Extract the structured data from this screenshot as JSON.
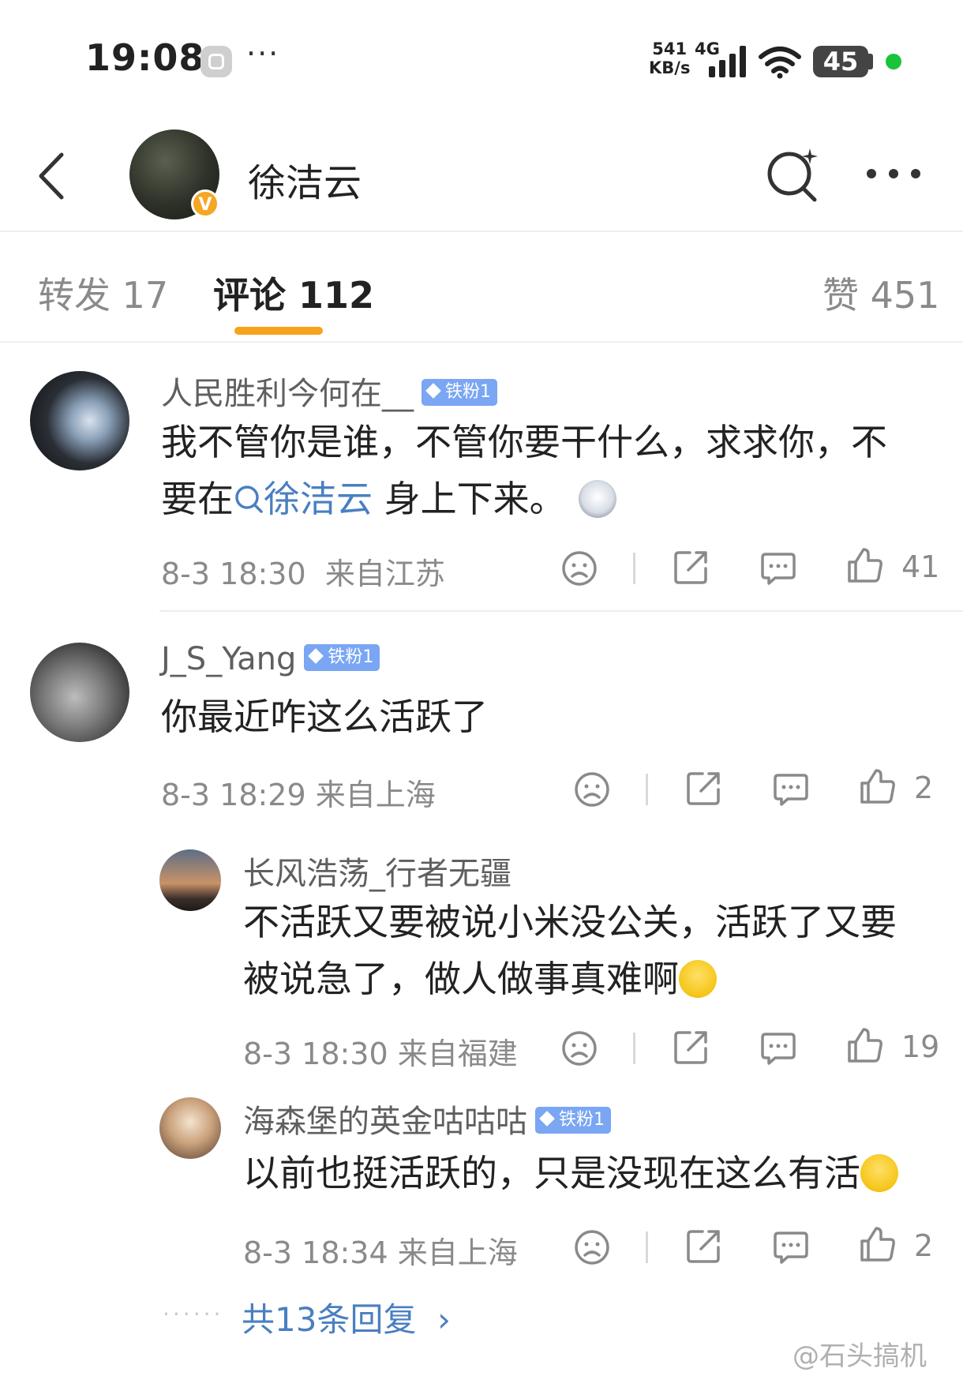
{
  "status_bar": {
    "time": "19:08",
    "more": "···",
    "speed_value": "541",
    "speed_unit": "KB/s",
    "network": "4G",
    "battery": "45"
  },
  "header": {
    "owner_name": "徐洁云",
    "verified_badge": "V"
  },
  "tabs": [
    {
      "label": "转发 17"
    },
    {
      "label": "评论 112"
    },
    {
      "label": "赞 451"
    }
  ],
  "comments": [
    {
      "user": "人民胜利今何在__",
      "badge": "铁粉1",
      "text_a": "我不管你是谁，不管你要干什么，求求你，不",
      "text_b": "要在",
      "mention": "徐洁云",
      "text_c": " 身上下来。",
      "time": "8-3 18:30",
      "location": "来自江苏",
      "likes": "41"
    },
    {
      "user": "J_S_Yang",
      "badge": "铁粉1",
      "text": "你最近咋这么活跃了",
      "time": "8-3 18:29",
      "location": "来自上海",
      "likes": "2"
    }
  ],
  "replies": [
    {
      "user": "长风浩荡_行者无疆",
      "text_a": "不活跃又要被说小米没公关，活跃了又要",
      "text_b": "被说急了，做人做事真难啊",
      "time": "8-3 18:30",
      "location": "来自福建",
      "likes": "19"
    },
    {
      "user": "海森堡的英金咕咕咕",
      "badge": "铁粉1",
      "text": "以前也挺活跃的，只是没现在这么有活",
      "time": "8-3 18:34",
      "location": "来自上海",
      "likes": "2"
    }
  ],
  "more_replies": "共13条回复",
  "more_replies_chevron": "›",
  "dots": "······",
  "watermark": "@石头搞机"
}
